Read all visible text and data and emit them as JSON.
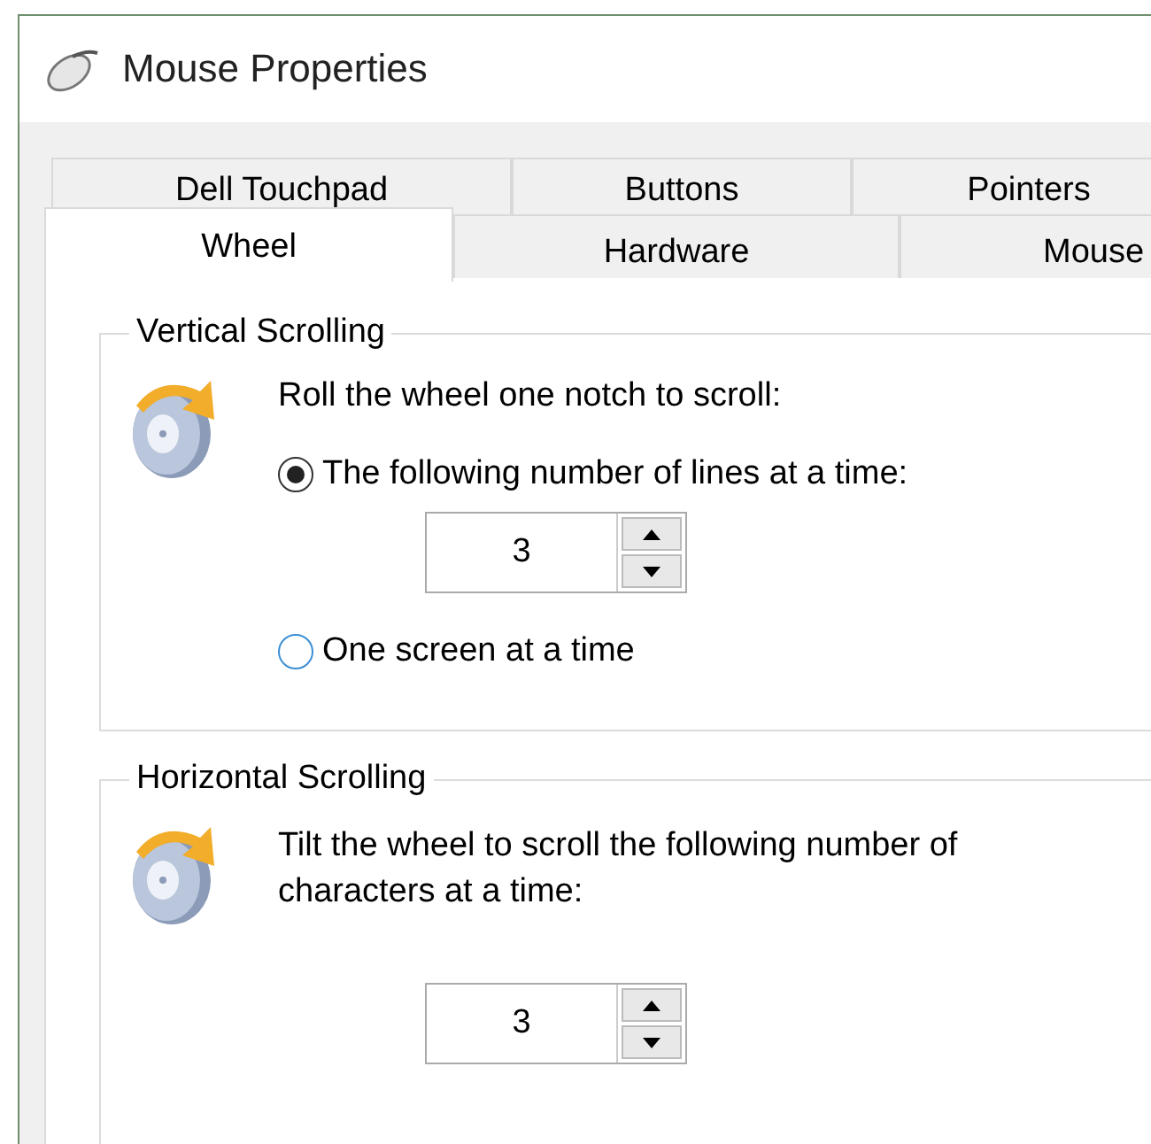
{
  "window": {
    "title": "Mouse Properties"
  },
  "tab_rows": [
    [
      {
        "label": "Dell Touchpad",
        "selected": false
      },
      {
        "label": "Buttons",
        "selected": false
      },
      {
        "label": "Pointers",
        "selected": false
      }
    ],
    [
      {
        "label": "Wheel",
        "selected": true
      },
      {
        "label": "Hardware",
        "selected": false
      },
      {
        "label": "Mouse",
        "selected": false
      }
    ]
  ],
  "vertical_scrolling": {
    "title": "Vertical Scrolling",
    "prompt": "Roll the wheel one notch to scroll:",
    "options": [
      {
        "label": "The following number of lines at a time:",
        "selected": true,
        "spinner": "3"
      },
      {
        "label": "One screen at a time",
        "selected": false
      }
    ]
  },
  "horizontal_scrolling": {
    "title": "Horizontal Scrolling",
    "prompt": "Tilt the wheel to scroll the following number of characters at a time:",
    "spinner": "3"
  }
}
